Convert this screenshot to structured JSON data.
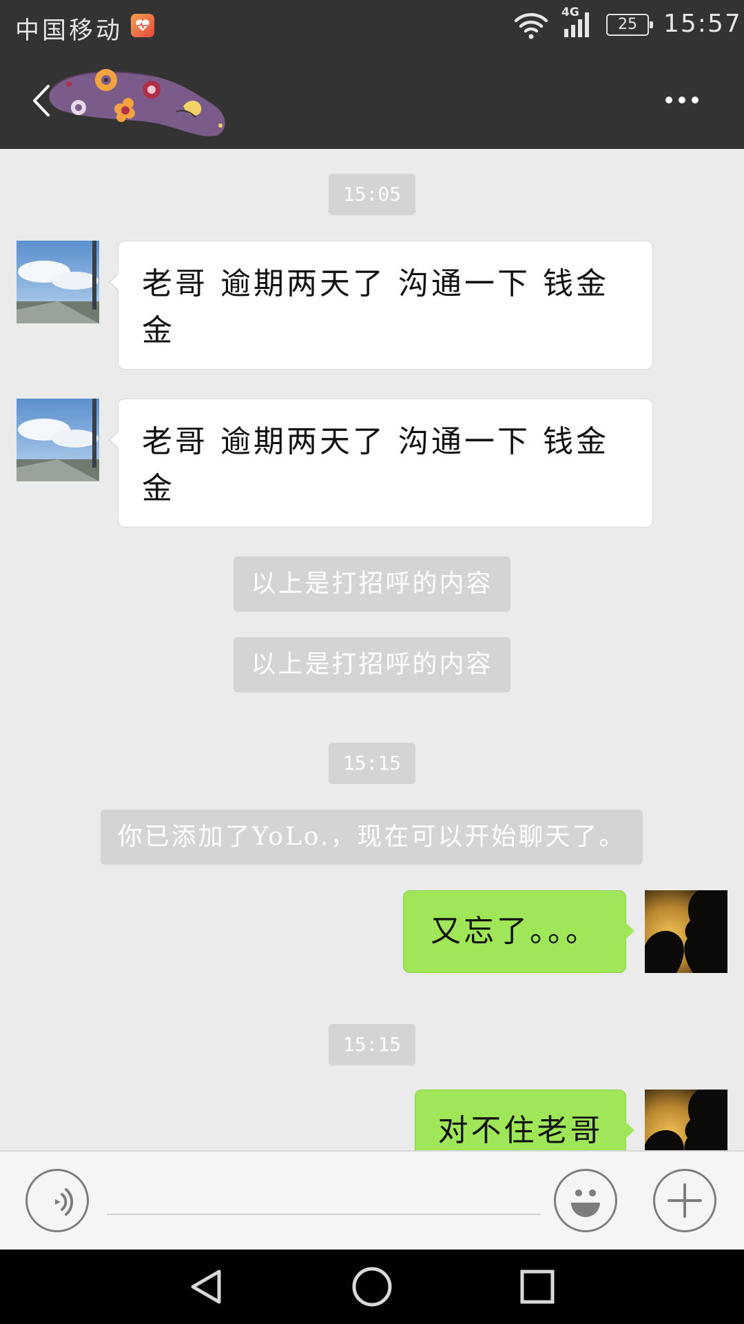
{
  "status_bar": {
    "carrier": "中国移动",
    "network": "4G",
    "battery": "25",
    "time": "15:57",
    "icons": [
      "health-app-icon",
      "wifi-icon",
      "signal-icon",
      "battery-icon"
    ]
  },
  "header": {
    "icons": [
      "back-arrow-icon",
      "sticker-title-image",
      "more-dots-icon"
    ]
  },
  "chat": {
    "time_1": "15:05",
    "message_1": "老哥 逾期两天了 沟通一下 钱金金",
    "message_2": "老哥 逾期两天了 沟通一下 钱金金",
    "system_1": "以上是打招呼的内容",
    "system_2": "以上是打招呼的内容",
    "time_2": "15:15",
    "system_3": "你已添加了YoLo.，现在可以开始聊天了。",
    "message_3": "又忘了。。。",
    "time_3": "15:15",
    "message_4": "对不住老哥"
  },
  "input_bar": {
    "value": "",
    "icons": [
      "voice-icon",
      "emoji-icon",
      "plus-icon"
    ]
  },
  "nav_bar": {
    "icons": [
      "back-triangle-icon",
      "home-circle-icon",
      "recents-square-icon"
    ]
  },
  "colors": {
    "bar_dark": "#333334",
    "chat_bg": "#ebebeb",
    "bubble_in": "#ffffff",
    "bubble_out": "#9fe658",
    "pill": "#d4d4d4"
  }
}
